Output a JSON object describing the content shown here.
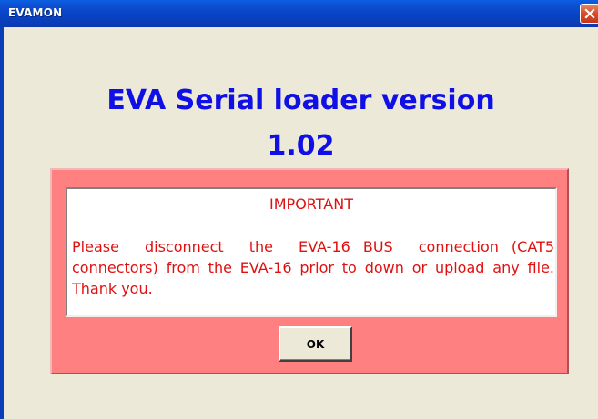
{
  "window": {
    "title": "EVAMON",
    "close_icon": "close-icon",
    "titlebar_color": "#0843c4",
    "background_color": "#ece9d8"
  },
  "heading": {
    "line1": "EVA Serial loader version",
    "line2": "1.02",
    "color": "#1010e6"
  },
  "notice": {
    "panel_color": "#ff8080",
    "text_color": "#e01010",
    "title": "IMPORTANT",
    "body": "Please  disconnect  the  EVA-16 BUS  connection (CAT5 connectors) from the EVA-16 prior to down or upload any file.      Thank you."
  },
  "ok_button": {
    "label": "OK"
  }
}
